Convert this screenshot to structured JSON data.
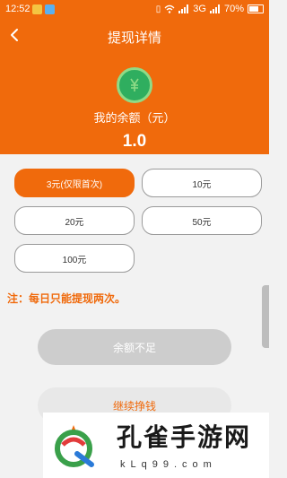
{
  "status_bar": {
    "time": "12:52",
    "network": "3G",
    "battery": "70%",
    "battery_level": 0.7
  },
  "nav": {
    "title": "提现详情",
    "back_icon": "chevron-left-icon"
  },
  "balance": {
    "icon": "coin-icon",
    "label": "我的余额（元）",
    "value": "1.0"
  },
  "options": [
    {
      "label": "3元(仅限首次)",
      "selected": true
    },
    {
      "label": "10元",
      "selected": false
    },
    {
      "label": "20元",
      "selected": false
    },
    {
      "label": "50元",
      "selected": false
    },
    {
      "label": "100元",
      "selected": false
    }
  ],
  "note": "注：每日只能提现两次。",
  "buttons": {
    "insufficient": "余额不足",
    "earn_more": "继续挣钱"
  },
  "watermark": {
    "title": "孔雀手游网",
    "domain": "kLq99.com"
  },
  "colors": {
    "accent": "#f06a0c",
    "coin": "#2fae5f",
    "disabled": "#cdcdcd"
  }
}
